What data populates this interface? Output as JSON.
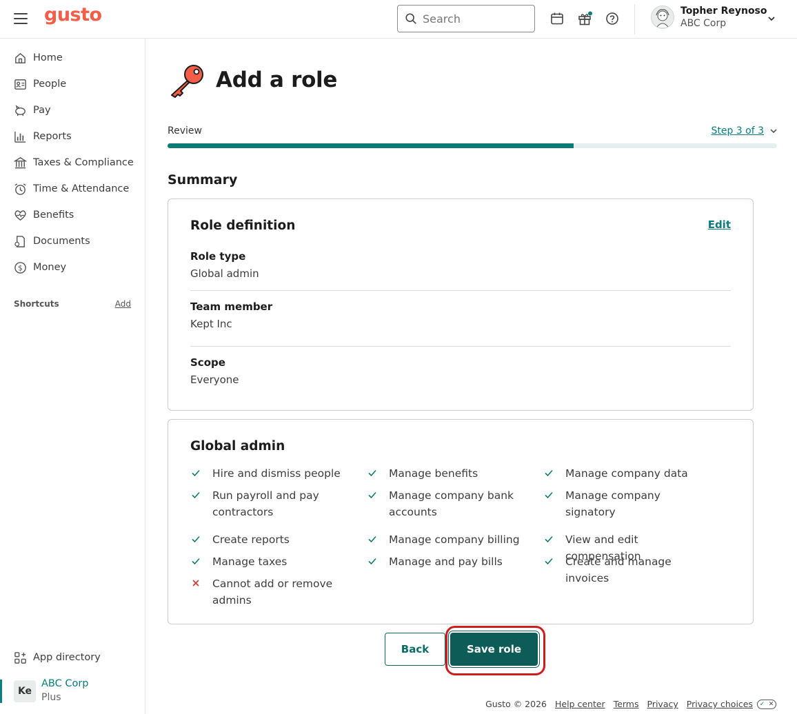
{
  "topbar": {
    "logo": "gusto",
    "search_placeholder": "Search",
    "user_name": "Topher Reynoso",
    "user_org": "ABC Corp",
    "icons": [
      "calendar-icon",
      "gift-icon",
      "help-icon"
    ]
  },
  "sidebar": {
    "items": [
      {
        "label": "Home",
        "icon": "home-icon"
      },
      {
        "label": "People",
        "icon": "people-icon"
      },
      {
        "label": "Pay",
        "icon": "piggy-bank-icon"
      },
      {
        "label": "Reports",
        "icon": "chart-icon"
      },
      {
        "label": "Taxes & Compliance",
        "icon": "building-icon"
      },
      {
        "label": "Time & Attendance",
        "icon": "clock-icon"
      },
      {
        "label": "Benefits",
        "icon": "heart-icon"
      },
      {
        "label": "Documents",
        "icon": "document-icon"
      },
      {
        "label": "Money",
        "icon": "dollar-icon"
      }
    ],
    "shortcuts_label": "Shortcuts",
    "shortcuts_add": "Add",
    "app_directory": "App directory",
    "company_initials": "Ke",
    "company_name": "ABC Corp",
    "company_plan": "Plus"
  },
  "page": {
    "title": "Add a role",
    "review_label": "Review",
    "step_label": "Step 3 of 3",
    "progress_fraction": 0.666,
    "summary_heading": "Summary"
  },
  "role_definition": {
    "heading": "Role definition",
    "edit_label": "Edit",
    "fields": [
      {
        "label": "Role type",
        "value": "Global admin"
      },
      {
        "label": "Team member",
        "value": "Kept Inc"
      },
      {
        "label": "Scope",
        "value": "Everyone"
      }
    ]
  },
  "permissions": {
    "heading": "Global admin",
    "columns": [
      [
        {
          "text": "Hire and dismiss people",
          "allowed": true
        },
        {
          "text": "Run payroll and pay contractors",
          "allowed": true
        },
        {
          "text": "Create reports",
          "allowed": true
        },
        {
          "text": "Manage taxes",
          "allowed": true
        },
        {
          "text": "Cannot add or remove admins",
          "allowed": false
        }
      ],
      [
        {
          "text": "Manage benefits",
          "allowed": true
        },
        {
          "text": "Manage company bank accounts",
          "allowed": true
        },
        {
          "text": "Manage company billing",
          "allowed": true
        },
        {
          "text": "Manage and pay bills",
          "allowed": true
        }
      ],
      [
        {
          "text": "Manage company data",
          "allowed": true
        },
        {
          "text": "Manage company signatory",
          "allowed": true
        },
        {
          "text": "View and edit compensation",
          "allowed": true
        },
        {
          "text": "Create and manage invoices",
          "allowed": true
        }
      ]
    ]
  },
  "actions": {
    "back_label": "Back",
    "save_label": "Save role"
  },
  "footer": {
    "copyright": "Gusto © 2026",
    "links": [
      "Help center",
      "Terms",
      "Privacy",
      "Privacy choices"
    ]
  },
  "colors": {
    "brand": "#f45d48",
    "accent": "#0a7c7c",
    "primary_button": "#0d5c57",
    "highlight": "#cf1d1d"
  }
}
